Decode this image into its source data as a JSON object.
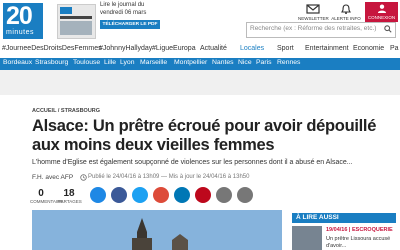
{
  "header": {
    "logo_number": "20",
    "logo_subtitle": "minutes",
    "read_line1": "Lire le journal du",
    "read_line2": "vendredi 06 mars",
    "download_label": "TÉLÉCHARGER LE PDF",
    "newsletter_label": "NEWSLETTER",
    "alerts_label": "ALERTE INFO",
    "connexion_label": "CONNEXION"
  },
  "nav": {
    "items": [
      "#JourneeDesDroitsDesFemmes",
      "#JohnnyHallyday",
      "#LigueEuropa",
      "Actualité",
      "Locales",
      "Sport",
      "Entertainment",
      "Economie",
      "Pa"
    ],
    "active_index": 4,
    "search_placeholder": "Recherche (ex : Réforme des retraites, etc.)"
  },
  "cities": [
    "Bordeaux",
    "Strasbourg",
    "Toulouse",
    "Lille",
    "Lyon",
    "Marseille",
    "Montpellier",
    "Nantes",
    "Nice",
    "Paris",
    "Rennes"
  ],
  "article": {
    "breadcrumb": "ACCUEIL / STRASBOURG",
    "title": "Alsace: Un prêtre écroué pour avoir dépouillé aux moins deux vieilles femmes",
    "lead": "L'homme d'Eglise est également soupçonné de violences sur les personnes dont il a abusé en Alsace...",
    "byline": "F.H. avec AFP",
    "dates": "Publié le 24/04/16 à 13h09 — Mis à jour le 24/04/16 à 13h50",
    "comments_count": "0",
    "comments_label": "COMMENTAIRE",
    "shares_count": "18",
    "shares_label": "PARTAGES"
  },
  "share_icons": [
    {
      "name": "messenger-icon",
      "color": "#1e88e5"
    },
    {
      "name": "facebook-icon",
      "color": "#3b5998"
    },
    {
      "name": "twitter-icon",
      "color": "#1da1f2"
    },
    {
      "name": "google-plus-icon",
      "color": "#dd4b39"
    },
    {
      "name": "linkedin-icon",
      "color": "#0077b5"
    },
    {
      "name": "pinterest-icon",
      "color": "#bd081c"
    },
    {
      "name": "print-icon",
      "color": "#777777"
    },
    {
      "name": "email-icon",
      "color": "#777777"
    }
  ],
  "aside": {
    "title": "À LIRE AUSSI",
    "date": "19/04/16 | ESCROQUERIE",
    "text": "Un prêtre Lissoura accusé d'avoir..."
  },
  "colors": {
    "brand_blue": "#1a7ec2",
    "connexion_red": "#c7163e"
  }
}
